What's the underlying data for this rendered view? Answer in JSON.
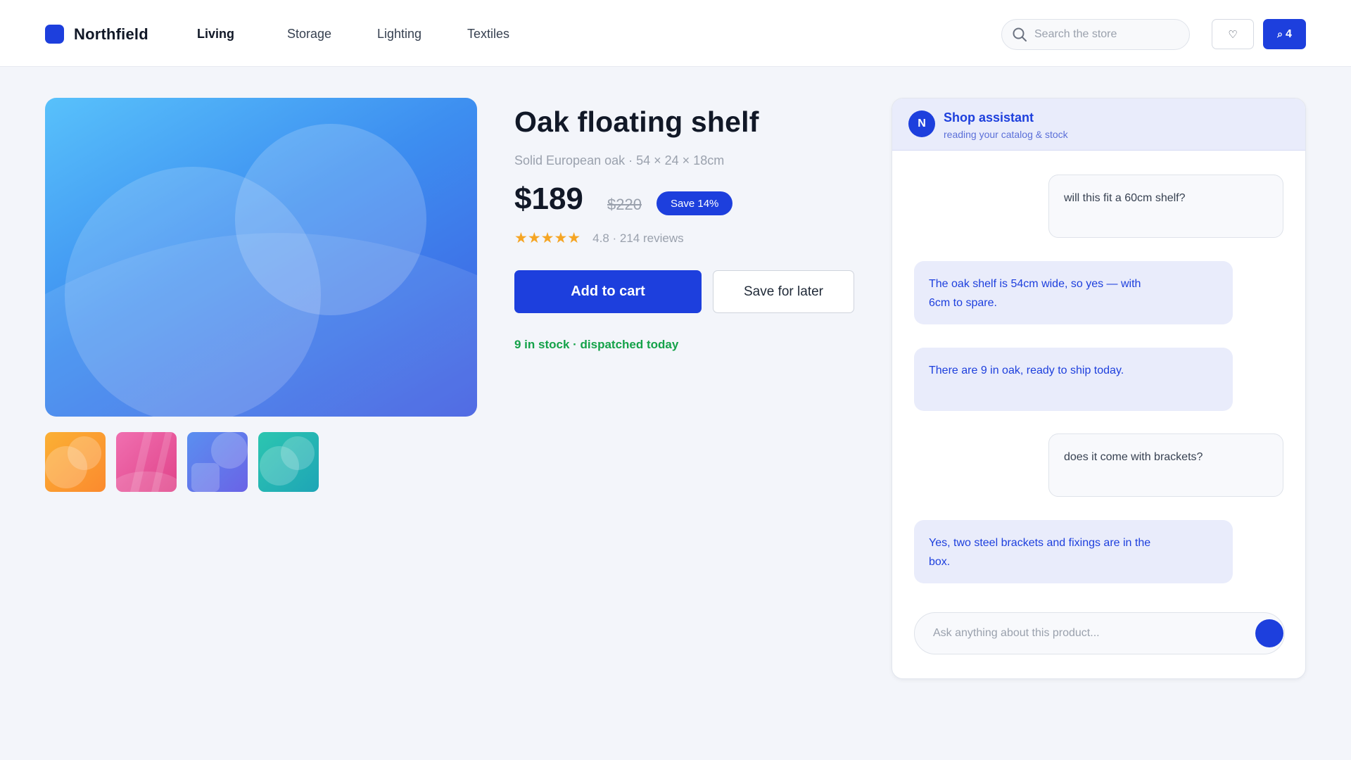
{
  "header": {
    "brand": "Northfield",
    "nav": [
      {
        "label": "Living",
        "active": true
      },
      {
        "label": "Storage",
        "active": false
      },
      {
        "label": "Lighting",
        "active": false
      },
      {
        "label": "Textiles",
        "active": false
      }
    ],
    "search_placeholder": "Search the store",
    "wishlist_icon": "heart-icon",
    "cart_icon": "search-icon",
    "cart_count": "4"
  },
  "product": {
    "title": "Oak floating shelf",
    "subtitle": "Solid European oak · 54 × 24 × 18cm",
    "price": "$189",
    "old_price": "$220",
    "save_label": "Save 14%",
    "stars": "★★★★★",
    "rating_text": "4.8 · 214 reviews",
    "add_to_cart": "Add to cart",
    "save_for_later": "Save for later",
    "stock": "9 in stock · dispatched today",
    "thumbnail_count": 4
  },
  "assistant": {
    "avatar_letter": "N",
    "name": "Shop assistant",
    "subtitle": "reading your catalog & stock",
    "messages": [
      {
        "role": "user",
        "text": "will this fit a 60cm shelf?"
      },
      {
        "role": "assistant",
        "text": "The oak shelf is 54cm wide, so yes — with 6cm to spare."
      },
      {
        "role": "assistant",
        "text": "There are 9 in oak, ready to ship today."
      },
      {
        "role": "user",
        "text": "does it come with brackets?"
      },
      {
        "role": "assistant",
        "text": "Yes, two steel brackets and fixings are in the box."
      }
    ],
    "input_placeholder": "Ask anything about this product..."
  },
  "colors": {
    "accent": "#1d3fdd",
    "stock_green": "#14a249",
    "star": "#f5a524",
    "background": "#f3f5fa"
  }
}
